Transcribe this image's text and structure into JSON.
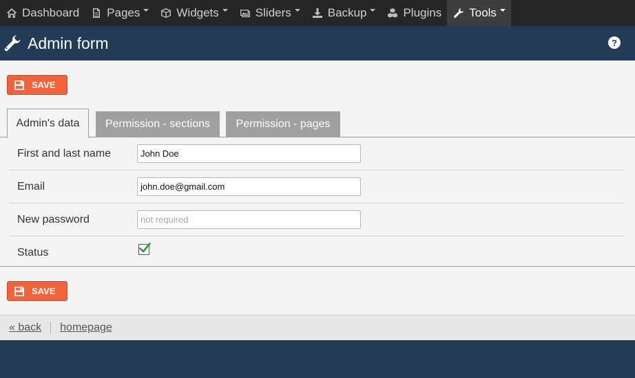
{
  "nav": {
    "items": [
      {
        "label": "Dashboard",
        "icon": "home-icon",
        "caret": false
      },
      {
        "label": "Pages",
        "icon": "document-icon",
        "caret": true
      },
      {
        "label": "Widgets",
        "icon": "cube-icon",
        "caret": true
      },
      {
        "label": "Sliders",
        "icon": "image-icon",
        "caret": true
      },
      {
        "label": "Backup",
        "icon": "download-icon",
        "caret": true
      },
      {
        "label": "Plugins",
        "icon": "cubes-icon",
        "caret": false
      },
      {
        "label": "Tools",
        "icon": "wrench-icon",
        "caret": true,
        "active": true
      }
    ]
  },
  "header": {
    "title": "Admin form",
    "help_label": "?"
  },
  "toolbar": {
    "save_label": "SAVE"
  },
  "tabs": [
    {
      "label": "Admin's data",
      "active": true
    },
    {
      "label": "Permission - sections",
      "active": false
    },
    {
      "label": "Permission - pages",
      "active": false
    }
  ],
  "form": {
    "name": {
      "label": "First and last name",
      "value": "John Doe",
      "placeholder": ""
    },
    "email": {
      "label": "Email",
      "value": "john.doe@gmail.com",
      "placeholder": ""
    },
    "password": {
      "label": "New password",
      "value": "",
      "placeholder": "not required"
    },
    "status": {
      "label": "Status",
      "checked": true
    }
  },
  "footer": {
    "back_label": "« back",
    "homepage_label": "homepage"
  },
  "colors": {
    "accent": "#f0633c",
    "header_bg": "#243b58",
    "nav_bg": "#262626",
    "check_green": "#2e9e2e"
  }
}
